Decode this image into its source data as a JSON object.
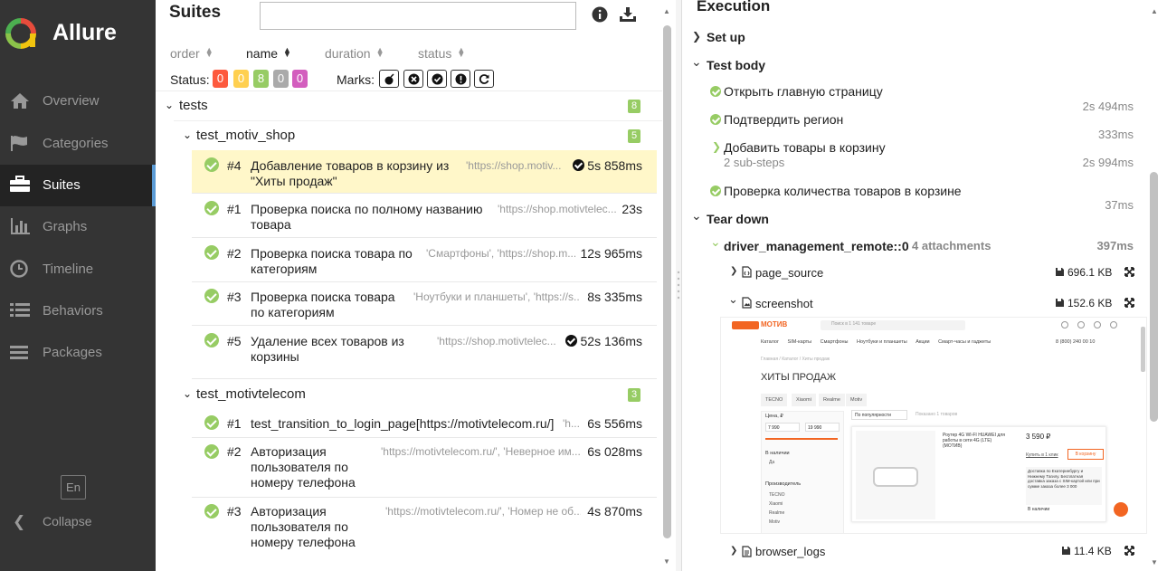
{
  "app": {
    "name": "Allure"
  },
  "sidebar": {
    "items": [
      {
        "label": "Overview",
        "icon": "home-icon"
      },
      {
        "label": "Categories",
        "icon": "flag-icon"
      },
      {
        "label": "Suites",
        "icon": "briefcase-icon"
      },
      {
        "label": "Graphs",
        "icon": "bar-chart-icon"
      },
      {
        "label": "Timeline",
        "icon": "clock-icon"
      },
      {
        "label": "Behaviors",
        "icon": "list-icon"
      },
      {
        "label": "Packages",
        "icon": "stacked-list-icon"
      }
    ],
    "active": "Suites",
    "lang": "En",
    "collapse": "Collapse"
  },
  "suites": {
    "title": "Suites",
    "search_value": "",
    "sort": {
      "order": "order",
      "name": "name",
      "duration": "duration",
      "status": "status"
    },
    "status_label": "Status:",
    "status_counts": [
      {
        "value": "0",
        "color": "#fd5a3e"
      },
      {
        "value": "0",
        "color": "#ffd050"
      },
      {
        "value": "8",
        "color": "#97cc64"
      },
      {
        "value": "0",
        "color": "#aaaaaa"
      },
      {
        "value": "0",
        "color": "#d35ebe"
      }
    ],
    "marks_label": "Marks:",
    "tree": {
      "root": {
        "label": "tests",
        "count": "8"
      },
      "groups": [
        {
          "label": "test_motiv_shop",
          "count": "5",
          "rows": [
            {
              "num": "#4",
              "name": "Добавление товаров в корзину из \"Хиты продаж\"",
              "params": "'https://shop.motiv...",
              "duration": "5s 858ms"
            },
            {
              "num": "#1",
              "name": "Проверка поиска по полному названию товара",
              "params": "'https://shop.motivtelec...",
              "duration": "23s"
            },
            {
              "num": "#2",
              "name": "Проверка поиска товара по категориям",
              "params": "'Смартфоны', 'https://shop.m...",
              "duration": "12s 965ms"
            },
            {
              "num": "#3",
              "name": "Проверка поиска товара по категориям",
              "params": "'Ноутбуки и планшеты', 'https://s...",
              "duration": "8s 335ms"
            },
            {
              "num": "#5",
              "name": "Удаление всех товаров из корзины",
              "params": "'https://shop.motivtelec...",
              "duration": "52s 136ms"
            }
          ]
        },
        {
          "label": "test_motivtelecom",
          "count": "3",
          "rows": [
            {
              "num": "#1",
              "name": "test_transition_to_login_page[https://motivtelecom.ru/]",
              "params": "'h...",
              "duration": "6s 556ms"
            },
            {
              "num": "#2",
              "name": "Авторизация пользователя по номеру телефона",
              "params": "'https://motivtelecom.ru/', 'Неверное им...",
              "duration": "6s 028ms"
            },
            {
              "num": "#3",
              "name": "Авторизация пользователя по номеру телефона",
              "params": "'https://motivtelecom.ru/', 'Номер не об...",
              "duration": "4s 870ms"
            }
          ]
        }
      ]
    }
  },
  "execution": {
    "title": "Execution",
    "setup": "Set up",
    "body": "Test body",
    "steps": [
      {
        "name": "Открыть главную страницу",
        "duration": "2s 494ms"
      },
      {
        "name": "Подтвердить регион",
        "duration": "333ms"
      },
      {
        "name": "Добавить товары в корзину",
        "sub": "2 sub-steps",
        "duration": "2s 994ms"
      },
      {
        "name": "Проверка количества товаров в корзине",
        "duration": "37ms"
      }
    ],
    "teardown": "Tear down",
    "fixture": {
      "name": "driver_management_remote::0",
      "attachments": "4 attachments",
      "duration": "397ms"
    },
    "attachments": [
      {
        "name": "page_source",
        "size": "696.1 KB"
      },
      {
        "name": "screenshot",
        "size": "152.6 KB"
      },
      {
        "name": "browser_logs",
        "size": "11.4 KB"
      }
    ],
    "screenshot": {
      "brand": "МОТИВ",
      "search_placeholder": "Поиск в 1 141 товаре",
      "menu": [
        "Каталог",
        "SIM-карты",
        "Смартфоны",
        "Ноутбуки и планшеты",
        "Акции",
        "Смарт-часы и гаджеты"
      ],
      "phone": "8 (800) 240 00 10",
      "crumbs": "Главная / Каталог / Хиты продаж",
      "heading": "ХИТЫ ПРОДАЖ",
      "brand_tabs": [
        "TECNO",
        "Xiaomi",
        "Realme",
        "Motiv"
      ],
      "filter_price": "Цена, ₽",
      "price_from": "7 990",
      "price_to": "19 990",
      "in_stock": "В наличии",
      "in_stock_yes": "Да",
      "producer": "Производитель",
      "producers": [
        "TECNO",
        "Xiaomi",
        "Realme",
        "Motiv"
      ],
      "sort_value": "По популярности",
      "show_goods": "Показано 1 товаров",
      "product_name": "Роутер 4G WI-FI HUAWEI для работы в сети 4G (LTE) (МОТИВ)",
      "product_price": "3 590 ₽",
      "buy_label": "В корзину",
      "compare": "Купить в 1 клик",
      "delivery": "Доставка по Екатеринбургу и Нижнему Тагилу. Бесплатная доставка заказа с SIM-картой или при сумме заказа более 3 000",
      "stock_state": "В наличии"
    }
  },
  "colors": {
    "passed": "#97cc64",
    "sidebar": "#343434",
    "selected_row": "#fff7c9",
    "motiv": "#f26522"
  }
}
